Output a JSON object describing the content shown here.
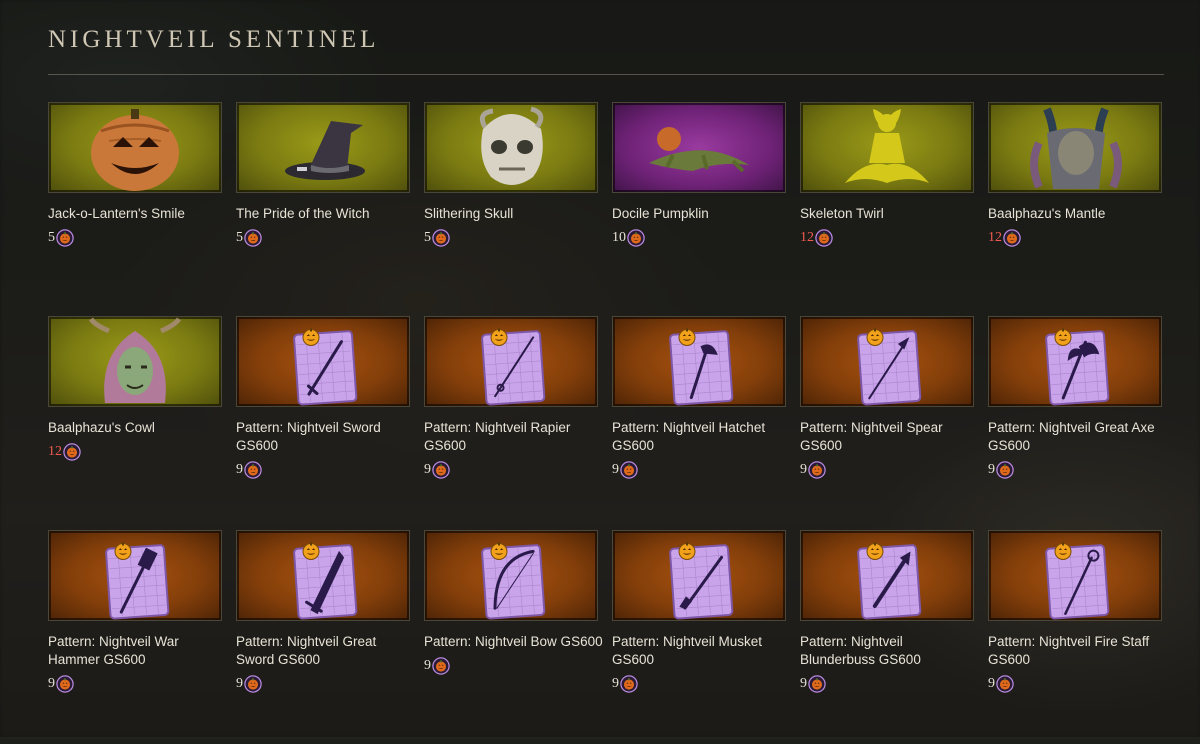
{
  "title": "NIGHTVEIL SENTINEL",
  "colors": {
    "olive_bg": "#8a8a14",
    "purple_bg": "#8a2f92",
    "orange_bg": "#96480c",
    "price_red": "#f05a50",
    "text": "#e8e3d6"
  },
  "currency_icon": "pumpkin-coin-icon",
  "items": [
    {
      "name": "Jack-o-Lantern's Smile",
      "price": "5",
      "price_red": false,
      "bg": "olive",
      "art": "pumpkin-head-icon"
    },
    {
      "name": "The Pride of the Witch",
      "price": "5",
      "price_red": false,
      "bg": "olive",
      "art": "witch-hat-icon"
    },
    {
      "name": "Slithering Skull",
      "price": "5",
      "price_red": false,
      "bg": "olive",
      "art": "skull-mask-icon"
    },
    {
      "name": "Docile Pumpklin",
      "price": "10",
      "price_red": false,
      "bg": "purple",
      "art": "lizard-pet-icon"
    },
    {
      "name": "Skeleton Twirl",
      "price": "12",
      "price_red": true,
      "bg": "olive",
      "art": "emote-silhouette-icon"
    },
    {
      "name": "Baalphazu's Mantle",
      "price": "12",
      "price_red": true,
      "bg": "olive",
      "art": "armor-chest-icon"
    },
    {
      "name": "Baalphazu's Cowl",
      "price": "12",
      "price_red": true,
      "bg": "olive",
      "art": "horned-hood-icon"
    },
    {
      "name": "Pattern: Nightveil Sword GS600",
      "price": "9",
      "price_red": false,
      "bg": "orange",
      "art": "pattern-sword-icon"
    },
    {
      "name": "Pattern: Nightveil Rapier GS600",
      "price": "9",
      "price_red": false,
      "bg": "orange",
      "art": "pattern-rapier-icon"
    },
    {
      "name": "Pattern: Nightveil Hatchet GS600",
      "price": "9",
      "price_red": false,
      "bg": "orange",
      "art": "pattern-hatchet-icon"
    },
    {
      "name": "Pattern: Nightveil Spear GS600",
      "price": "9",
      "price_red": false,
      "bg": "orange",
      "art": "pattern-spear-icon"
    },
    {
      "name": "Pattern: Nightveil Great Axe GS600",
      "price": "9",
      "price_red": false,
      "bg": "orange",
      "art": "pattern-great-axe-icon"
    },
    {
      "name": "Pattern: Nightveil War Hammer GS600",
      "price": "9",
      "price_red": false,
      "bg": "orange",
      "art": "pattern-war-hammer-icon"
    },
    {
      "name": "Pattern: Nightveil Great Sword GS600",
      "price": "9",
      "price_red": false,
      "bg": "orange",
      "art": "pattern-great-sword-icon"
    },
    {
      "name": "Pattern: Nightveil Bow GS600",
      "price": "9",
      "price_red": false,
      "bg": "orange",
      "art": "pattern-bow-icon"
    },
    {
      "name": "Pattern: Nightveil Musket GS600",
      "price": "9",
      "price_red": false,
      "bg": "orange",
      "art": "pattern-musket-icon"
    },
    {
      "name": "Pattern: Nightveil Blunderbuss GS600",
      "price": "9",
      "price_red": false,
      "bg": "orange",
      "art": "pattern-blunderbuss-icon"
    },
    {
      "name": "Pattern: Nightveil Fire Staff GS600",
      "price": "9",
      "price_red": false,
      "bg": "orange",
      "art": "pattern-fire-staff-icon"
    }
  ]
}
